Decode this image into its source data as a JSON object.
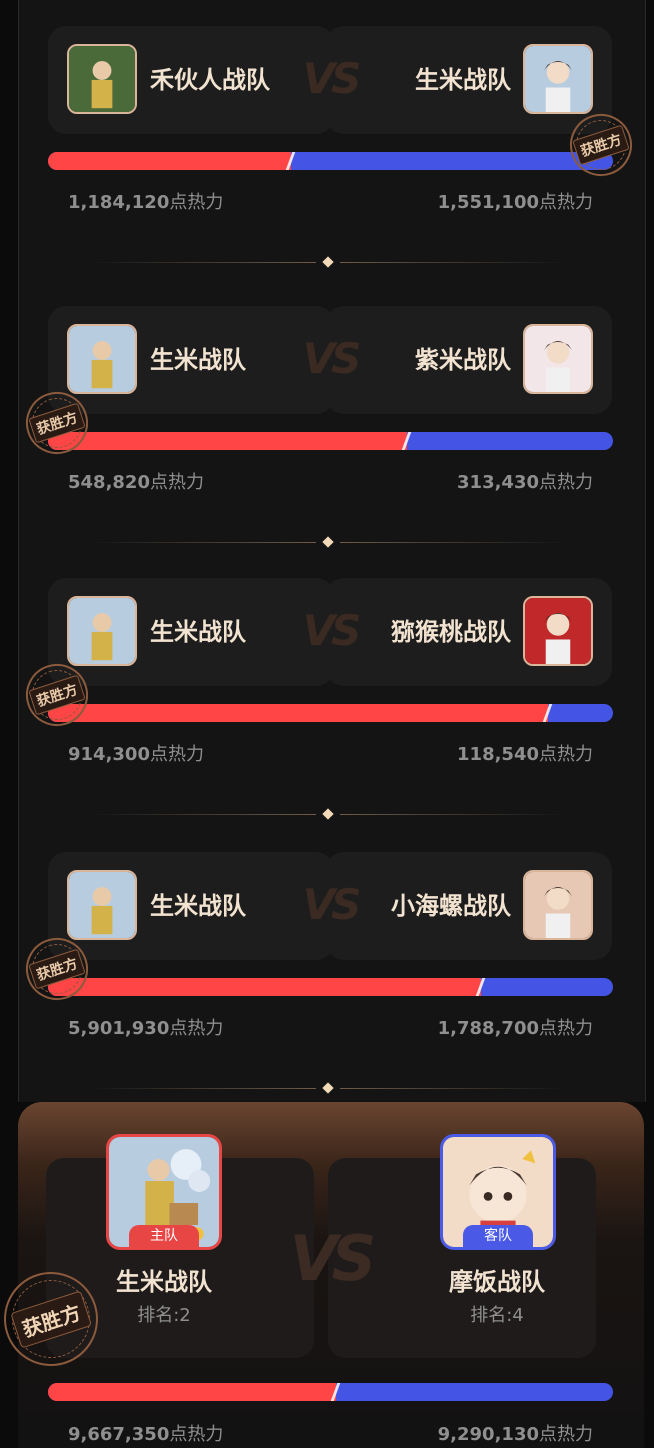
{
  "matches": [
    {
      "left_team": "禾伙人战队",
      "right_team": "生米战队",
      "left_score": "1,184,120",
      "right_score": "1,551,100",
      "unit": "点热力",
      "winner": "right",
      "left_share": 0.43
    },
    {
      "left_team": "生米战队",
      "right_team": "紫米战队",
      "left_score": "548,820",
      "right_score": "313,430",
      "unit": "点热力",
      "winner": "left",
      "left_share": 0.636
    },
    {
      "left_team": "生米战队",
      "right_team": "猕猴桃战队",
      "left_score": "914,300",
      "right_score": "118,540",
      "unit": "点热力",
      "winner": "left",
      "left_share": 0.885
    },
    {
      "left_team": "生米战队",
      "right_team": "小海螺战队",
      "left_score": "5,901,930",
      "right_score": "1,788,700",
      "unit": "点热力",
      "winner": "left",
      "left_share": 0.767
    }
  ],
  "vs_label": "VS",
  "winner_stamp": "获胜方",
  "final": {
    "home_badge": "主队",
    "away_badge": "客队",
    "home_team": "生米战队",
    "away_team": "摩饭战队",
    "home_rank": "排名:2",
    "away_rank": "排名:4",
    "home_score": "9,667,350",
    "away_score": "9,290,130",
    "unit": "点热力",
    "home_share": 0.51,
    "winner_stamp": "获胜方",
    "vs_label": "VS"
  },
  "colors": {
    "red": "#ff4545",
    "blue": "#4455e6",
    "gold": "#f2d9b8"
  }
}
